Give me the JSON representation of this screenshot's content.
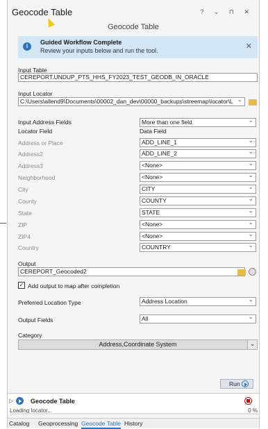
{
  "pane": {
    "title": "Geocode Table",
    "subtitle": "Geocode Table",
    "controls": "? ⌄ ⊓ ✕"
  },
  "banner": {
    "title": "Guided Workflow Complete",
    "message": "Review your inputs below and run the tool.",
    "close": "✕",
    "icon": "info-icon"
  },
  "input_table": {
    "label": "Input Table",
    "value": "CEREPORT.UNDUP_PTS_HHS_FY2023_TEST_GEODB_IN_ORACLE"
  },
  "input_locator": {
    "label": "Input Locator",
    "value": "C:\\Users\\allend9\\Documents\\00002_dan_dev\\00000_backups\\streemap\\locator\\L"
  },
  "address_fields": {
    "label": "Input Address Fields",
    "value": "More than one field",
    "col_locator": "Locator Field",
    "col_data": "Data Field",
    "rows": [
      {
        "name": "Address or Place",
        "value": "ADD_LINE_1"
      },
      {
        "name": "Address2",
        "value": "ADD_LINE_2"
      },
      {
        "name": "Address3",
        "value": "<None>"
      },
      {
        "name": "Neighborhood",
        "value": "<None>"
      },
      {
        "name": "City",
        "value": "CITY"
      },
      {
        "name": "County",
        "value": "COUNTY"
      },
      {
        "name": "State",
        "value": "STATE"
      },
      {
        "name": "ZIP",
        "value": "<None>"
      },
      {
        "name": "ZIP4",
        "value": "<None>"
      },
      {
        "name": "Country",
        "value": "COUNTRY"
      }
    ]
  },
  "output": {
    "label": "Output",
    "value": "CEREPORT_Geocoded2"
  },
  "add_to_map": {
    "label": "Add output to map after completion",
    "checked": "✓"
  },
  "location_type": {
    "label": "Preferred Location Type",
    "value": "Address Location"
  },
  "output_fields": {
    "label": "Output Fields",
    "value": "All"
  },
  "category": {
    "label": "Category",
    "value": "Address,Coordinate System",
    "arrow": "⌄"
  },
  "run": {
    "label": "Run"
  },
  "job": {
    "title": "Geocode Table",
    "status": "Loading locator...",
    "percent": "0 %",
    "progress": 0,
    "expander": "▷"
  },
  "tabs": [
    "Catalog",
    "Geoprocessing",
    "Geocode Table",
    "History"
  ],
  "active_tab": "Geocode Table",
  "colors": {
    "accent": "#2f73b8",
    "banner": "#d3e6f5",
    "stop": "#cc0000",
    "folder": "#e8b84a"
  }
}
